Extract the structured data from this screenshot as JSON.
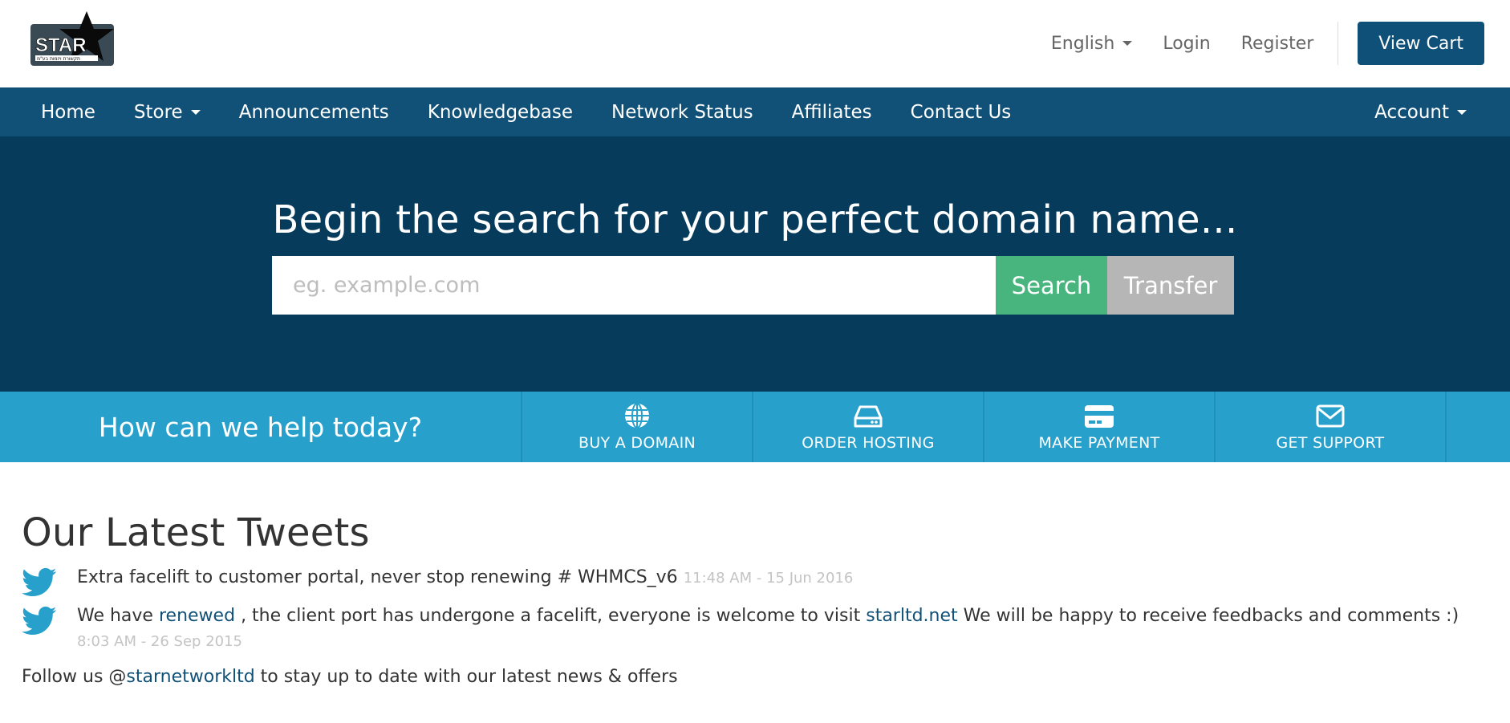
{
  "header": {
    "logo_text": "STAR",
    "logo_subtext": "תקשורת ויזמות בע\"מ",
    "language": "English",
    "login": "Login",
    "register": "Register",
    "view_cart": "View Cart"
  },
  "nav": {
    "items": [
      "Home",
      "Store",
      "Announcements",
      "Knowledgebase",
      "Network Status",
      "Affiliates",
      "Contact Us"
    ],
    "account": "Account"
  },
  "hero": {
    "title": "Begin the search for your perfect domain name...",
    "search_placeholder": "eg. example.com",
    "search_button": "Search",
    "transfer_button": "Transfer"
  },
  "help": {
    "title": "How can we help today?",
    "actions": [
      {
        "label": "BUY A DOMAIN",
        "icon": "globe-icon"
      },
      {
        "label": "ORDER HOSTING",
        "icon": "server-icon"
      },
      {
        "label": "MAKE PAYMENT",
        "icon": "credit-card-icon"
      },
      {
        "label": "GET SUPPORT",
        "icon": "envelope-icon"
      }
    ]
  },
  "tweets": {
    "title": "Our Latest Tweets",
    "items": [
      {
        "text_before": "Extra facelift to customer portal, never stop renewing # WHMCS_v6",
        "time": "11:48 AM - 15 Jun 2016"
      },
      {
        "text_before": "We have",
        "link1": "renewed",
        "text_mid": ", the client port has undergone a facelift, everyone is welcome to visit",
        "link2": "starltd.net",
        "text_after": "We will be happy to receive feedbacks and comments :)",
        "time": "8:03 AM - 26 Sep 2015"
      }
    ],
    "follow_before": "Follow us @",
    "follow_handle": "starnetworkltd",
    "follow_after": " to stay up to date with our latest news & offers"
  },
  "colors": {
    "brand_dark": "#063b5c",
    "nav": "#115178",
    "accent": "#27a1cc",
    "search_green": "#48b57e",
    "transfer_gray": "#b6b6b6"
  }
}
